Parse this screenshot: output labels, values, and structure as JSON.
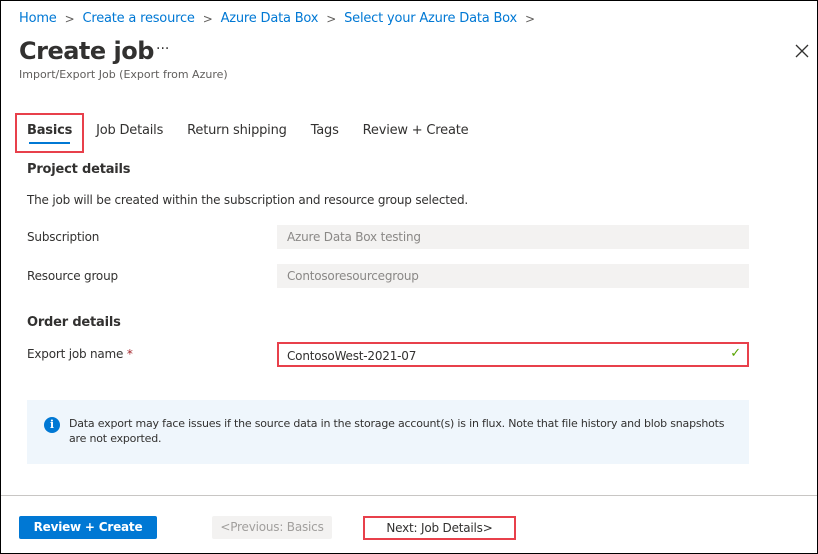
{
  "breadcrumb": [
    {
      "label": "Home"
    },
    {
      "label": "Create a resource"
    },
    {
      "label": "Azure Data Box"
    },
    {
      "label": "Select your Azure Data Box"
    }
  ],
  "header": {
    "title": "Create job",
    "more_label": "···",
    "subtitle": "Import/Export Job (Export from Azure)",
    "close_icon": "close-icon"
  },
  "tabs": [
    {
      "label": "Basics",
      "active": true
    },
    {
      "label": "Job Details"
    },
    {
      "label": "Return shipping"
    },
    {
      "label": "Tags"
    },
    {
      "label": "Review + Create"
    }
  ],
  "project": {
    "heading": "Project details",
    "description": "The job will be created within the subscription and resource group selected.",
    "subscription_label": "Subscription",
    "subscription_value": "Azure Data Box testing",
    "resource_group_label": "Resource group",
    "resource_group_value": "Contosoresourcegroup"
  },
  "order": {
    "heading": "Order details",
    "job_name_label": "Export job name",
    "required_marker": "*",
    "job_name_value": "ContosoWest-2021-07",
    "valid_icon": "✓"
  },
  "info": {
    "icon": "i",
    "message": "Data export may face issues if the source data in the storage account(s) is in flux. Note that file history and blob snapshots are not exported."
  },
  "footer": {
    "review_create": "Review + Create",
    "previous": "<Previous: Basics",
    "next": "Next: Job Details>"
  }
}
